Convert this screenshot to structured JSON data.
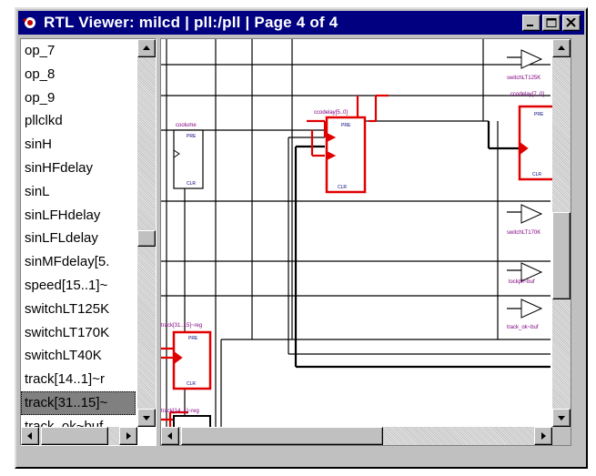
{
  "window": {
    "title": "RTL Viewer: milcd | pll:/pll | Page 4 of 4",
    "buttons": [
      "minimize",
      "maximize",
      "close"
    ]
  },
  "list": {
    "items": [
      "op_7",
      "op_8",
      "op_9",
      "pllclkd",
      "sinH",
      "sinHFdelay",
      "sinL",
      "sinLFHdelay",
      "sinLFLdelay",
      "sinMFdelay[5.",
      "speed[15..1]~",
      "switchLT125K",
      "switchLT170K",
      "switchLT40K",
      "track[14..1]~r",
      "track[31..15]~",
      "track_ok~buf"
    ],
    "selected_index": 15
  },
  "schematic": {
    "labels": {
      "coolume": "coolume",
      "ccodelay1": "ccodelay[5..0]",
      "ccodelay2": "ccodelay[7..0]",
      "sw125": "switchLT125K",
      "sw170": "switchLT170K",
      "lockpll": "lockpll~buf",
      "trackok": "track_ok~buf",
      "track1": "track[31..15]~reg",
      "track2": "track[14..1]~reg",
      "pre": "PRE",
      "ena": "ENA",
      "clr": "CLR"
    }
  }
}
